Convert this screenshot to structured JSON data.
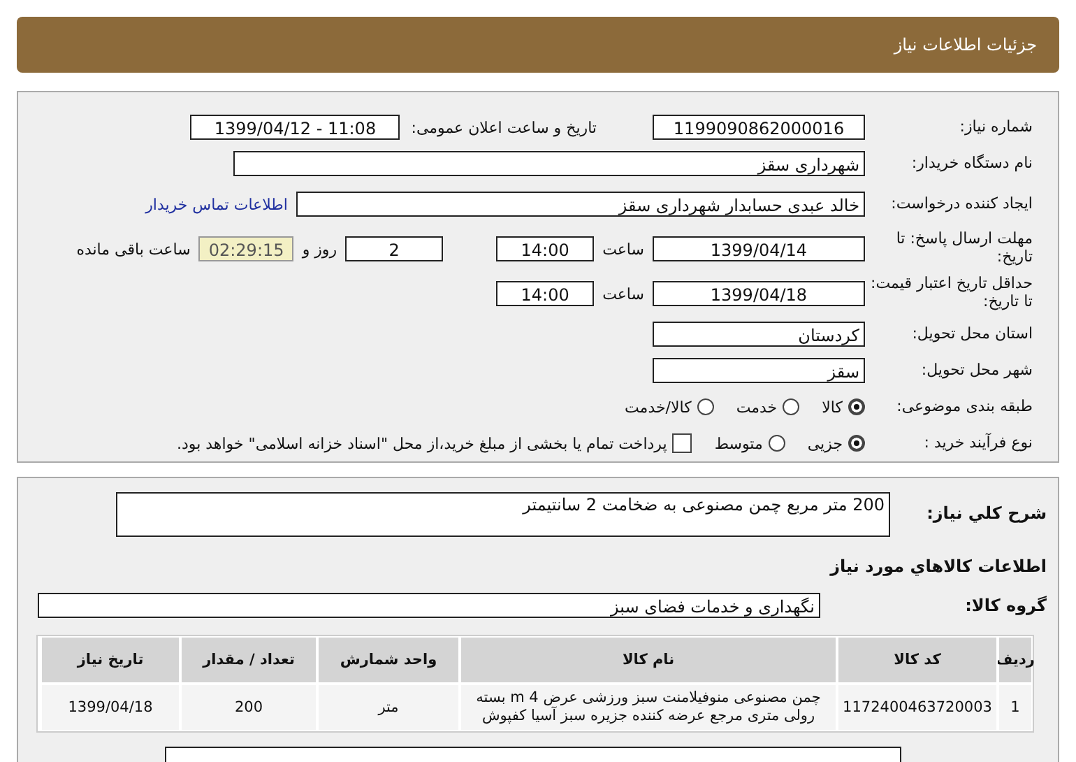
{
  "header": {
    "title": "جزئیات اطلاعات نیاز"
  },
  "need_number": {
    "label": "شماره نیاز:",
    "value": "1199090862000016"
  },
  "announce": {
    "label": "تاریخ و ساعت اعلان عمومی:",
    "value": "1399/04/12 - 11:08"
  },
  "buyer_org": {
    "label": "نام دستگاه خریدار:",
    "value": "شهرداری سقز"
  },
  "requester": {
    "label": "ایجاد کننده درخواست:",
    "value": "خالد عبدی حسابدار شهرداری سقز",
    "link": "اطلاعات تماس خریدار"
  },
  "reply_deadline": {
    "label": "مهلت ارسال پاسخ: تا تاریخ:",
    "date": "1399/04/14",
    "time_label": "ساعت",
    "time": "14:00",
    "days": "2",
    "days_label": "روز و",
    "remaining": "02:29:15",
    "remaining_label": "ساعت باقی مانده"
  },
  "price_validity": {
    "label": "حداقل تاریخ اعتبار قیمت: تا تاریخ:",
    "date": "1399/04/18",
    "time_label": "ساعت",
    "time": "14:00"
  },
  "province": {
    "label": "استان محل تحویل:",
    "value": "کردستان"
  },
  "city": {
    "label": "شهر محل تحویل:",
    "value": "سقز"
  },
  "category": {
    "label": "طبقه بندی موضوعی:",
    "options": [
      {
        "label": "کالا",
        "selected": true
      },
      {
        "label": "خدمت",
        "selected": false
      },
      {
        "label": "کالا/خدمت",
        "selected": false
      }
    ]
  },
  "process": {
    "label": "نوع فرآیند خرید :",
    "options": [
      {
        "label": "جزیی",
        "selected": true
      },
      {
        "label": "متوسط",
        "selected": false
      }
    ],
    "treasury": {
      "checked": false,
      "text": "پرداخت تمام یا بخشی از مبلغ خرید،از محل \"اسناد خزانه اسلامی\" خواهد بود."
    }
  },
  "description": {
    "label": "شرح کلي نياز:",
    "value": "200 متر مربع چمن مصنوعی به ضخامت 2 سانتیمتر"
  },
  "goods_heading": "اطلاعات کالاهاي مورد نياز",
  "goods_group": {
    "label": "گروه کالا:",
    "value": "نگهداری و خدمات فضای سبز"
  },
  "table": {
    "columns": [
      "ردیف",
      "کد کالا",
      "نام کالا",
      "واحد شمارش",
      "تعداد / مقدار",
      "تاریخ نیاز"
    ],
    "rows": [
      [
        "1",
        "1172400463720003",
        "چمن مصنوعی منوفیلامنت سبز ورزشی عرض m 4 بسته رولی متری مرجع عرضه کننده جزیره سبز آسیا کفپوش",
        "متر",
        "200",
        "1399/04/18"
      ]
    ]
  }
}
